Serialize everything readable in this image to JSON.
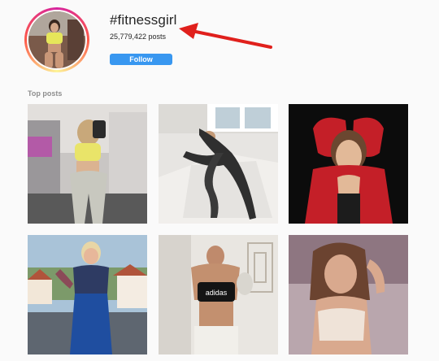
{
  "header": {
    "hashtag": "#fitnessgirl",
    "post_count": "25,779,422 posts",
    "follow_label": "Follow"
  },
  "sections": {
    "top_posts_label": "Top posts"
  },
  "top_posts": [
    {
      "name": "post-mirror-selfie"
    },
    {
      "name": "post-floor-stretch"
    },
    {
      "name": "post-red-jacket"
    },
    {
      "name": "post-balcony"
    },
    {
      "name": "post-adidas-top"
    },
    {
      "name": "post-selfie-smile"
    }
  ],
  "colors": {
    "follow_button": "#3897f0",
    "arrow": "#e0201c",
    "muted_text": "#8e8e8e"
  }
}
